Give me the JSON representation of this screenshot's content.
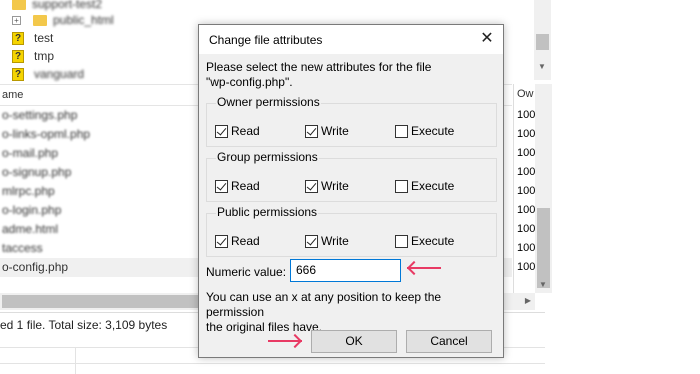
{
  "background": {
    "tree": [
      {
        "label": "support-test2",
        "icon": "folder"
      },
      {
        "label": "public_html",
        "icon": "folder"
      },
      {
        "label": "test",
        "icon": "question"
      },
      {
        "label": "tmp",
        "icon": "question"
      },
      {
        "label": "vanguard",
        "icon": "question"
      }
    ],
    "list_header": "ame",
    "right_header": "Ow",
    "files": [
      "o-settings.php",
      "o-links-opml.php",
      "o-mail.php",
      "o-signup.php",
      "mlrpc.php",
      "o-login.php",
      "adme.html",
      "taccess",
      "o-config.php"
    ],
    "right_values": [
      "100",
      "100",
      "100",
      "100",
      "100",
      "100",
      "100",
      "100",
      "100"
    ],
    "status_text": "ed 1 file. Total size: 3,109 bytes"
  },
  "dialog": {
    "title": "Change file attributes",
    "close_glyph": "✕",
    "prompt_line1": "Please select the new attributes for the file",
    "prompt_line2": "\"wp-config.php\".",
    "groups": [
      {
        "label": "Owner permissions",
        "read": "Read",
        "write": "Write",
        "execute": "Execute",
        "read_checked": true,
        "write_checked": true,
        "execute_checked": false
      },
      {
        "label": "Group permissions",
        "read": "Read",
        "write": "Write",
        "execute": "Execute",
        "read_checked": true,
        "write_checked": true,
        "execute_checked": false
      },
      {
        "label": "Public permissions",
        "read": "Read",
        "write": "Write",
        "execute": "Execute",
        "read_checked": true,
        "write_checked": true,
        "execute_checked": false
      }
    ],
    "numeric_label": "Numeric value:",
    "numeric_value": "666",
    "hint_line1": "You can use an x at any position to keep the permission",
    "hint_line2": "the original files have.",
    "ok_label": "OK",
    "cancel_label": "Cancel"
  },
  "colors": {
    "arrow": "#e83a64",
    "input_focus": "#0078d7",
    "dialog_bg": "#f0f0f0"
  }
}
